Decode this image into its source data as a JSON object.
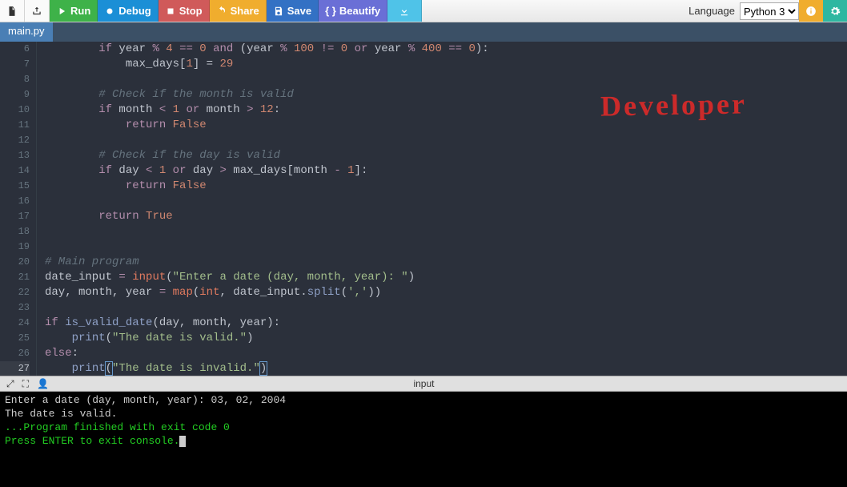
{
  "toolbar": {
    "run": "Run",
    "debug": "Debug",
    "stop": "Stop",
    "share": "Share",
    "save": "Save",
    "beautify": "Beautify",
    "language_label": "Language",
    "language_value": "Python 3"
  },
  "tabs": [
    "main.py"
  ],
  "annotation": "Developer",
  "gutter_start": 6,
  "gutter_end": 27,
  "code_lines": [
    {
      "indent": 2,
      "tokens": [
        [
          "kw",
          "if"
        ],
        [
          "",
          " year "
        ],
        [
          "kw",
          "%"
        ],
        [
          "",
          " "
        ],
        [
          "num",
          "4"
        ],
        [
          "",
          " "
        ],
        [
          "kw",
          "=="
        ],
        [
          "",
          " "
        ],
        [
          "num",
          "0"
        ],
        [
          "",
          " "
        ],
        [
          "kw",
          "and"
        ],
        [
          "",
          " (year "
        ],
        [
          "kw",
          "%"
        ],
        [
          "",
          " "
        ],
        [
          "num",
          "100"
        ],
        [
          "",
          " "
        ],
        [
          "kw",
          "!="
        ],
        [
          "",
          " "
        ],
        [
          "num",
          "0"
        ],
        [
          "",
          " "
        ],
        [
          "kw",
          "or"
        ],
        [
          "",
          " year "
        ],
        [
          "kw",
          "%"
        ],
        [
          "",
          " "
        ],
        [
          "num",
          "400"
        ],
        [
          "",
          " "
        ],
        [
          "kw",
          "=="
        ],
        [
          "",
          " "
        ],
        [
          "num",
          "0"
        ],
        [
          "",
          "):"
        ]
      ]
    },
    {
      "indent": 3,
      "tokens": [
        [
          "",
          "max_days["
        ],
        [
          "num",
          "1"
        ],
        [
          "",
          "] = "
        ],
        [
          "num",
          "29"
        ]
      ]
    },
    {
      "indent": 0,
      "tokens": []
    },
    {
      "indent": 2,
      "tokens": [
        [
          "cm",
          "# Check if the month is valid"
        ]
      ]
    },
    {
      "indent": 2,
      "tokens": [
        [
          "kw",
          "if"
        ],
        [
          "",
          " month "
        ],
        [
          "kw",
          "<"
        ],
        [
          "",
          " "
        ],
        [
          "num",
          "1"
        ],
        [
          "",
          " "
        ],
        [
          "kw",
          "or"
        ],
        [
          "",
          " month "
        ],
        [
          "kw",
          ">"
        ],
        [
          "",
          " "
        ],
        [
          "num",
          "12"
        ],
        [
          "",
          ":"
        ]
      ]
    },
    {
      "indent": 3,
      "tokens": [
        [
          "kw",
          "return"
        ],
        [
          "",
          " "
        ],
        [
          "bool",
          "False"
        ]
      ]
    },
    {
      "indent": 0,
      "tokens": []
    },
    {
      "indent": 2,
      "tokens": [
        [
          "cm",
          "# Check if the day is valid"
        ]
      ]
    },
    {
      "indent": 2,
      "tokens": [
        [
          "kw",
          "if"
        ],
        [
          "",
          " day "
        ],
        [
          "kw",
          "<"
        ],
        [
          "",
          " "
        ],
        [
          "num",
          "1"
        ],
        [
          "",
          " "
        ],
        [
          "kw",
          "or"
        ],
        [
          "",
          " day "
        ],
        [
          "kw",
          ">"
        ],
        [
          "",
          " max_days[month "
        ],
        [
          "kw",
          "-"
        ],
        [
          "",
          " "
        ],
        [
          "num",
          "1"
        ],
        [
          "",
          "]:"
        ]
      ]
    },
    {
      "indent": 3,
      "tokens": [
        [
          "kw",
          "return"
        ],
        [
          "",
          " "
        ],
        [
          "bool",
          "False"
        ]
      ]
    },
    {
      "indent": 0,
      "tokens": []
    },
    {
      "indent": 2,
      "tokens": [
        [
          "kw",
          "return"
        ],
        [
          "",
          " "
        ],
        [
          "bool",
          "True"
        ]
      ]
    },
    {
      "indent": 0,
      "tokens": []
    },
    {
      "indent": 0,
      "tokens": []
    },
    {
      "indent": 0,
      "tokens": [
        [
          "cm",
          "# Main program"
        ]
      ]
    },
    {
      "indent": 0,
      "tokens": [
        [
          "",
          "date_input "
        ],
        [
          "kw",
          "="
        ],
        [
          "",
          " "
        ],
        [
          "builtin",
          "input"
        ],
        [
          "",
          "("
        ],
        [
          "str",
          "\"Enter a date (day, month, year): \""
        ],
        [
          "",
          ")"
        ]
      ]
    },
    {
      "indent": 0,
      "tokens": [
        [
          "",
          "day, month, year "
        ],
        [
          "kw",
          "="
        ],
        [
          "",
          " "
        ],
        [
          "builtin",
          "map"
        ],
        [
          "",
          "("
        ],
        [
          "builtin",
          "int"
        ],
        [
          "",
          ", date_input."
        ],
        [
          "fn",
          "split"
        ],
        [
          "",
          "("
        ],
        [
          "str",
          "','"
        ],
        [
          "",
          "))"
        ]
      ]
    },
    {
      "indent": 0,
      "tokens": []
    },
    {
      "indent": 0,
      "tokens": [
        [
          "kw",
          "if"
        ],
        [
          "",
          " "
        ],
        [
          "fn",
          "is_valid_date"
        ],
        [
          "",
          "(day, month, year):"
        ]
      ]
    },
    {
      "indent": 1,
      "tokens": [
        [
          "fn",
          "print"
        ],
        [
          "",
          "("
        ],
        [
          "str",
          "\"The date is valid.\""
        ],
        [
          "",
          ")"
        ]
      ]
    },
    {
      "indent": 0,
      "tokens": [
        [
          "kw",
          "else"
        ],
        [
          "",
          ":"
        ]
      ]
    },
    {
      "indent": 1,
      "tokens": [
        [
          "fn",
          "print"
        ],
        [
          "hl",
          "("
        ],
        [
          "str",
          "\"The date is invalid.\""
        ],
        [
          "hl",
          ")"
        ]
      ]
    }
  ],
  "console_bar": {
    "label": "input"
  },
  "console": {
    "lines": [
      {
        "cls": "",
        "text": "Enter a date (day, month, year): 03, 02, 2004"
      },
      {
        "cls": "",
        "text": "The date is valid."
      },
      {
        "cls": "",
        "text": ""
      },
      {
        "cls": "",
        "text": ""
      },
      {
        "cls": "c-green",
        "text": "...Program finished with exit code 0"
      },
      {
        "cls": "c-green",
        "text": "Press ENTER to exit console."
      }
    ]
  }
}
